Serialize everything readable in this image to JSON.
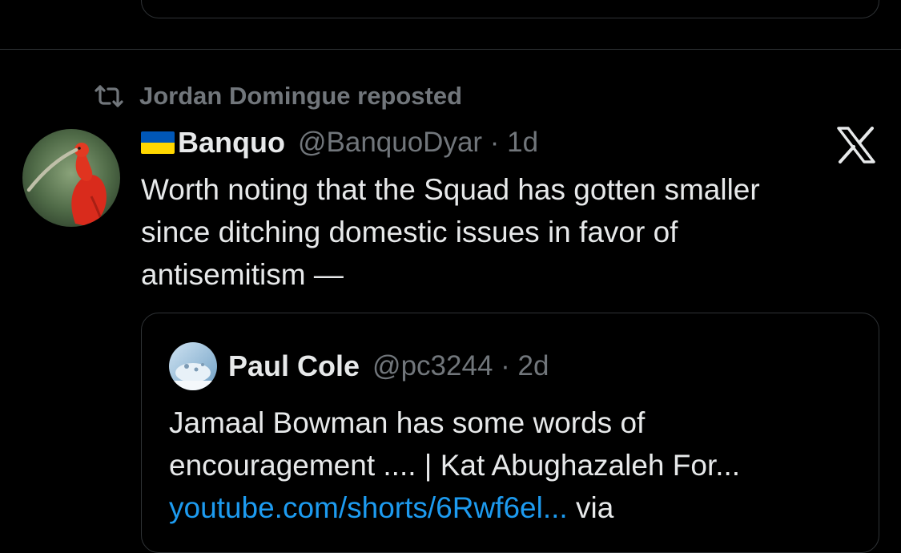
{
  "repost": {
    "label": "Jordan Domingue reposted",
    "icon": "repost-icon"
  },
  "tweet": {
    "flag": "ukraine-flag",
    "display_name": "Banquo",
    "handle_time": "@BanquoDyar · 1d",
    "line1": "Worth noting that the Squad has gotten smaller",
    "line2": "since ditching domestic issues in favor of",
    "line3": "antisemitism —",
    "avatar": "scarlet-ibis-avatar",
    "platform_icon": "x-logo-icon"
  },
  "quote": {
    "display_name": "Paul Cole",
    "handle_time": "@pc3244 · 2d",
    "line1": "Jamaal Bowman has some words of",
    "line2": "encouragement .... | Kat Abughazaleh For...",
    "link": "youtube.com/shorts/6Rwf6el...",
    "via": " via"
  },
  "colors": {
    "background": "#000000",
    "text": "#e7e9ea",
    "muted": "#71767b",
    "border": "#2f3336",
    "link": "#1d9bf0"
  }
}
